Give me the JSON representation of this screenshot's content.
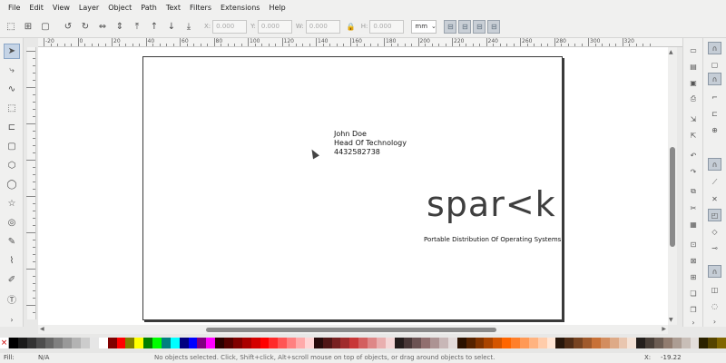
{
  "menu": [
    "File",
    "Edit",
    "View",
    "Layer",
    "Object",
    "Path",
    "Text",
    "Filters",
    "Extensions",
    "Help"
  ],
  "toolbar": {
    "x_label": "X:",
    "x_value": "0.000",
    "y_label": "Y:",
    "y_value": "0.000",
    "w_label": "W:",
    "w_value": "0.000",
    "h_label": "H:",
    "h_value": "0.000",
    "unit": "mm"
  },
  "ruler": {
    "top_labels": [
      "-20",
      "0",
      "20",
      "40",
      "60",
      "80",
      "100",
      "120",
      "140",
      "160",
      "180",
      "200",
      "220",
      "240",
      "260",
      "280",
      "300",
      "320"
    ]
  },
  "page": {
    "name": "John Doe",
    "title": "Head Of Technology",
    "phone": "4432582738",
    "logo": "spar<k",
    "tagline": "Portable Distribution Of Operating Systems"
  },
  "palette": [
    "#000000",
    "#1a1a1a",
    "#333333",
    "#4d4d4d",
    "#666666",
    "#808080",
    "#999999",
    "#b3b3b3",
    "#cccccc",
    "#e6e6e6",
    "#ffffff",
    "#800000",
    "#ff0000",
    "#808000",
    "#ffff00",
    "#008000",
    "#00ff00",
    "#008080",
    "#00ffff",
    "#000080",
    "#0000ff",
    "#800080",
    "#ff00ff",
    "#2b0000",
    "#550000",
    "#800000",
    "#aa0000",
    "#d40000",
    "#ff0000",
    "#ff2a2a",
    "#ff5555",
    "#ff8080",
    "#ffaaaa",
    "#ffd5d5",
    "#280b0b",
    "#501616",
    "#782121",
    "#a02c2c",
    "#c83737",
    "#d35f5f",
    "#de8787",
    "#e9afaf",
    "#f4d7d7",
    "#241c1c",
    "#483737",
    "#6c5353",
    "#916f6f",
    "#ac9393",
    "#c8b7b7",
    "#e3dbdb",
    "#2b1100",
    "#552200",
    "#803300",
    "#aa4400",
    "#d45500",
    "#ff6600",
    "#ff7f2a",
    "#ff9955",
    "#ffb380",
    "#ffccaa",
    "#ffe6d5",
    "#28170b",
    "#502d16",
    "#784421",
    "#a05a2c",
    "#c87137",
    "#d38d5f",
    "#deaa87",
    "#e9c6af",
    "#f4e3d7",
    "#241f1c",
    "#483e37",
    "#6c5d53",
    "#917c6f",
    "#ac9d93",
    "#c8beb7",
    "#e3dedb",
    "#2b2200",
    "#554400",
    "#806600"
  ],
  "status": {
    "fill_label": "Fill:",
    "fill_value": "N/A",
    "message": "No objects selected. Click, Shift+click, Alt+scroll mouse on top of objects, or drag around objects to select.",
    "x_label": "X:",
    "x_value": "-19.22"
  }
}
